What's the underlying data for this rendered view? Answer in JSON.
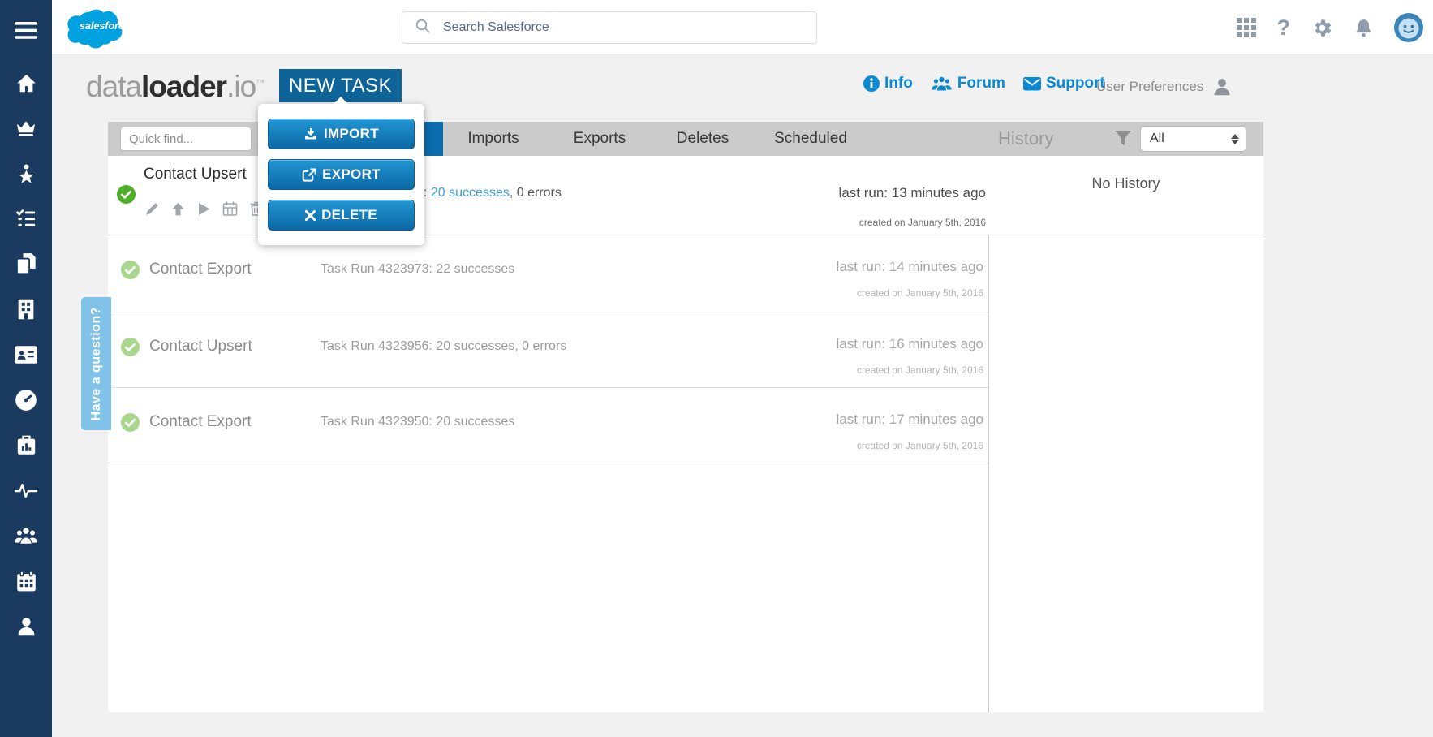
{
  "colors": {
    "sidebar_navy": "#1b3a5f",
    "accent_blue": "#0e6399",
    "active_tab_blue": "#0a6cad",
    "link_blue": "#0b89d2",
    "success_green": "#4caf27",
    "success_green_light": "#a9d78e",
    "tabbar_gray": "#cbcbcb",
    "question_tab_blue": "#80c2e8",
    "salesforce_blue": "#00a1e0"
  },
  "topbar": {
    "brand": "salesforce",
    "search_placeholder": "Search Salesforce",
    "icons": [
      "waffle-icon",
      "help-icon",
      "setup-gear-icon",
      "notification-bell-icon",
      "avatar"
    ]
  },
  "header": {
    "logo_data": "data",
    "logo_loader": "loader",
    "logo_io": ".io",
    "logo_tm": "™",
    "new_task": "NEW TASK",
    "links": [
      {
        "label": "Info",
        "icon": "info-icon"
      },
      {
        "label": "Forum",
        "icon": "forum-people-icon"
      },
      {
        "label": "Support",
        "icon": "support-envelope-icon"
      }
    ],
    "user_preferences": "User Preferences"
  },
  "menu": {
    "items": [
      {
        "label": "IMPORT",
        "icon": "import-icon"
      },
      {
        "label": "EXPORT",
        "icon": "export-icon"
      },
      {
        "label": "DELETE",
        "icon": "delete-x-icon"
      }
    ]
  },
  "tabbar": {
    "quick_find_placeholder": "Quick find...",
    "tabs": [
      "Imports",
      "Exports",
      "Deletes",
      "Scheduled"
    ],
    "history": "History",
    "filter_value": "All"
  },
  "sidebar": {
    "icons": [
      "menu-icon",
      "home-icon",
      "crown-icon",
      "star-figure-icon",
      "tasks-checklist-icon",
      "copy-icon",
      "company-building-icon",
      "contacts-card-icon",
      "dashboard-gauge-icon",
      "reports-case-icon",
      "activity-pulse-icon",
      "community-people-icon",
      "calendar-icon",
      "profile-person-icon"
    ]
  },
  "tasks": [
    {
      "title": "Contact Upsert",
      "run_prefix": ":",
      "run_link": "20 successes",
      "run_suffix": ", 0 errors",
      "last_run": "last run: 13 minutes ago",
      "created": "created on January 5th, 2016",
      "status": "success"
    },
    {
      "title": "Contact Export",
      "run_text": "Task Run 4323973: 22 successes",
      "last_run": "last run: 14 minutes ago",
      "created": "created on January 5th, 2016",
      "status": "success"
    },
    {
      "title": "Contact Upsert",
      "run_text": "Task Run 4323956: 20 successes, 0 errors",
      "last_run": "last run: 16 minutes ago",
      "created": "created on January 5th, 2016",
      "status": "success"
    },
    {
      "title": "Contact Export",
      "run_text": "Task Run 4323950: 20 successes",
      "last_run": "last run: 17 minutes ago",
      "created": "created on January 5th, 2016",
      "status": "success"
    }
  ],
  "history_panel": {
    "empty": "No History"
  },
  "question_tab": {
    "label": "Have a question?"
  }
}
